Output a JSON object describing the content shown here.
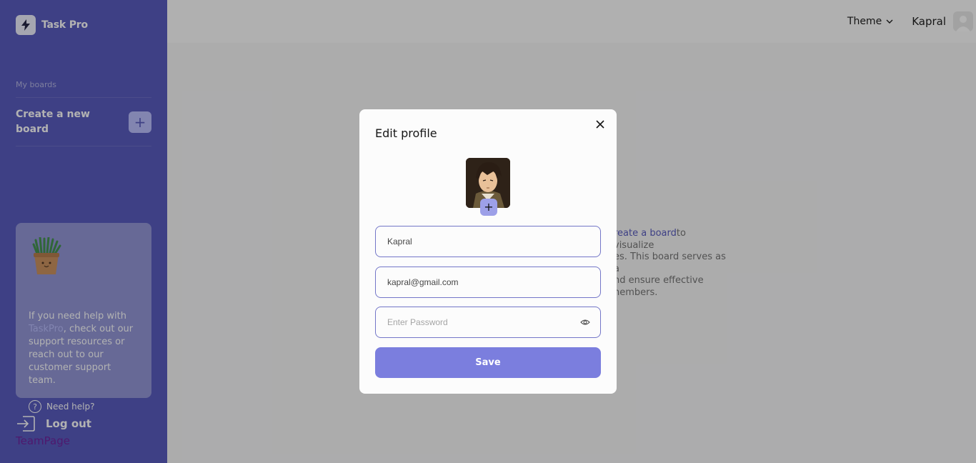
{
  "app": {
    "name": "Task Pro"
  },
  "sidebar": {
    "section_label": "My boards",
    "create_board_label": "Create a new board",
    "create_board_button": "+",
    "help": {
      "text_before": "If you need help with ",
      "link": "TaskPro",
      "text_after": ", check out our support resources or reach out to our customer support team.",
      "need_help": "Need help?"
    },
    "logout": "Log out",
    "teampage": "TeamPage"
  },
  "header": {
    "theme_label": "Theme",
    "user_name": "Kapral"
  },
  "main": {
    "link_fragment": "reate a board",
    "line1_rest": "to visualize",
    "line2": "es. This board serves as a",
    "line3": "nd ensure effective",
    "line4": "nembers."
  },
  "modal": {
    "title": "Edit profile",
    "avatar_add": "+",
    "name_value": "Kapral",
    "email_value": "kapral@gmail.com",
    "password_placeholder": "Enter Password",
    "save_label": "Save"
  },
  "colors": {
    "sidebar_bg": "#5255BC",
    "accent": "#7B7EDE",
    "overlay": "rgba(21,21,21,0.33)"
  },
  "icons": {
    "logo": "lightning-icon",
    "close": "close-icon",
    "eye": "eye-icon",
    "help": "question-icon",
    "logout": "logout-icon",
    "chevron": "chevron-down-icon"
  }
}
